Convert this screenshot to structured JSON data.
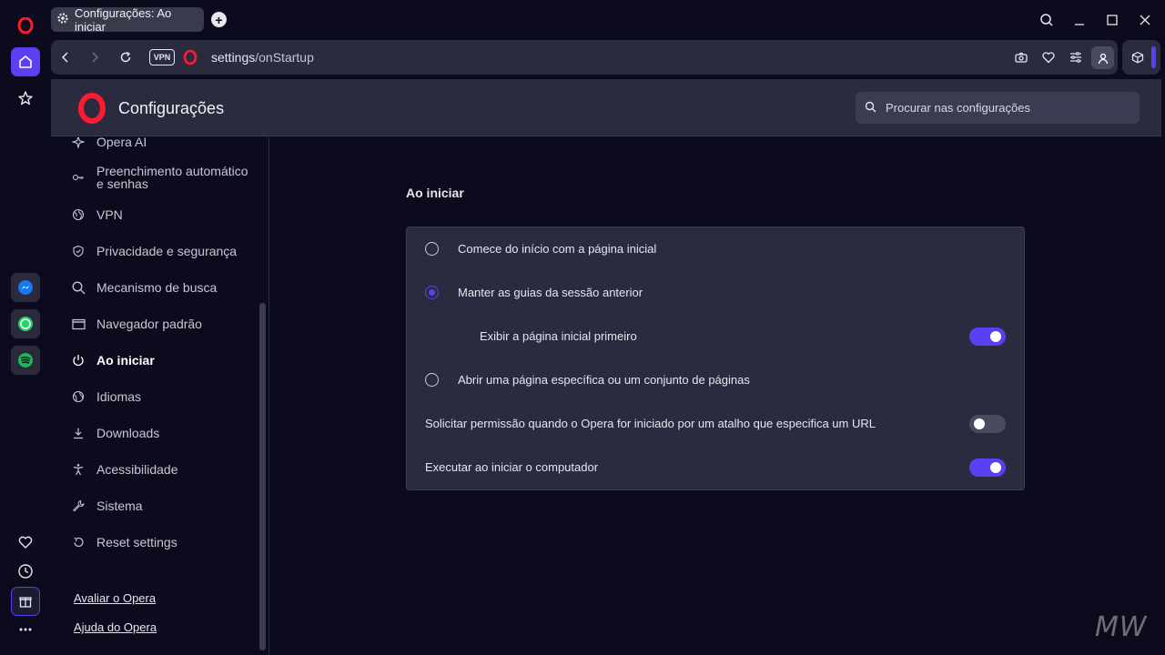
{
  "tab": {
    "title": "Configurações: Ao iniciar"
  },
  "address": {
    "vpn_label": "VPN",
    "url_prefix": "settings",
    "url_suffix": "/onStartup"
  },
  "settings": {
    "title": "Configurações",
    "search_placeholder": "Procurar nas configurações"
  },
  "nav": {
    "items": [
      {
        "label": "Opera AI",
        "icon": "sparkle-icon"
      },
      {
        "label": "Preenchimento automático e senhas",
        "icon": "key-icon"
      },
      {
        "label": "VPN",
        "icon": "globe-icon"
      },
      {
        "label": "Privacidade e segurança",
        "icon": "shield-icon"
      },
      {
        "label": "Mecanismo de busca",
        "icon": "search-icon"
      },
      {
        "label": "Navegador padrão",
        "icon": "browser-window-icon"
      },
      {
        "label": "Ao iniciar",
        "icon": "power-icon",
        "active": true
      },
      {
        "label": "Idiomas",
        "icon": "language-globe-icon"
      },
      {
        "label": "Downloads",
        "icon": "download-icon"
      },
      {
        "label": "Acessibilidade",
        "icon": "accessibility-icon"
      },
      {
        "label": "Sistema",
        "icon": "wrench-icon"
      },
      {
        "label": "Reset settings",
        "icon": "reset-icon"
      }
    ],
    "footer": {
      "rate": "Avaliar o Opera",
      "help": "Ajuda do Opera"
    }
  },
  "startup": {
    "section_title": "Ao iniciar",
    "options": [
      {
        "label": "Comece do início com a página inicial",
        "checked": false
      },
      {
        "label": "Manter as guias da sessão anterior",
        "checked": true
      },
      {
        "label": "Abrir uma página específica ou um conjunto de páginas",
        "checked": false
      }
    ],
    "sub_toggle": {
      "label": "Exibir a página inicial primeiro",
      "on": true
    },
    "toggles": [
      {
        "label": "Solicitar permissão quando o Opera for iniciado por um atalho que especifica um URL",
        "on": false
      },
      {
        "label": "Executar ao iniciar o computador",
        "on": true
      }
    ]
  },
  "colors": {
    "accent": "#5b3ff2",
    "panel": "#2b2b3f",
    "background": "#0b0b1d"
  },
  "watermark": "MW"
}
